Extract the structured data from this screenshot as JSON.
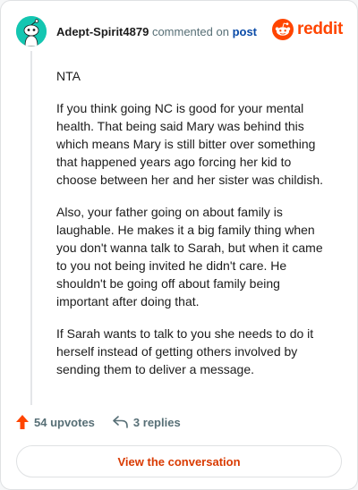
{
  "header": {
    "username": "Adept-Spirit4879",
    "action_text": "commented on",
    "link_text": "post",
    "brand": "reddit"
  },
  "comment": {
    "paragraphs": [
      "NTA",
      "If you think going NC is good for your mental health. That being said Mary was behind this which means Mary is still bitter over something that happened years ago forcing her kid to choose between her and her sister was childish.",
      "Also, your father going on about family is laughable. He makes it a big family thing when you don't wanna talk to Sarah, but when it came to you not being invited he didn't care. He shouldn't be going off about family being important after doing that.",
      "If Sarah wants to talk to you she needs to do it herself instead of getting others involved by sending them to deliver a message."
    ]
  },
  "actions": {
    "upvotes": "54 upvotes",
    "replies": "3 replies"
  },
  "footer": {
    "view_button": "View the conversation"
  },
  "colors": {
    "brand": "#ff4500",
    "avatar_bg": "#14c6b1",
    "link": "#0a4ba8",
    "button_text": "#d93a00"
  }
}
